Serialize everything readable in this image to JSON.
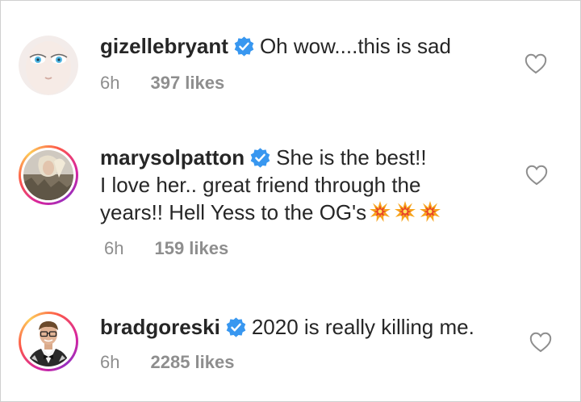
{
  "comments": [
    {
      "username": "gizellebryant",
      "verified": true,
      "text_lines": [
        "Oh wow....this is sad"
      ],
      "time": "6h",
      "likes": "397 likes",
      "avatar_ring": false
    },
    {
      "username": "marysolpatton",
      "verified": true,
      "text_lines": [
        "She is the best!!",
        "I love her.. great friend through the",
        "years!! Hell Yess to the OG's"
      ],
      "emoji": [
        "collision-emoji",
        "collision-emoji",
        "collision-emoji"
      ],
      "time": "6h",
      "likes": "159 likes",
      "avatar_ring": true
    },
    {
      "username": "bradgoreski",
      "verified": true,
      "text_lines": [
        "2020 is really killing me."
      ],
      "time": "6h",
      "likes": "2285 likes",
      "avatar_ring": true
    }
  ],
  "colors": {
    "text": "#262626",
    "meta": "#8e8e8e",
    "verified": "#3897f0",
    "border": "#cfcfcf"
  }
}
